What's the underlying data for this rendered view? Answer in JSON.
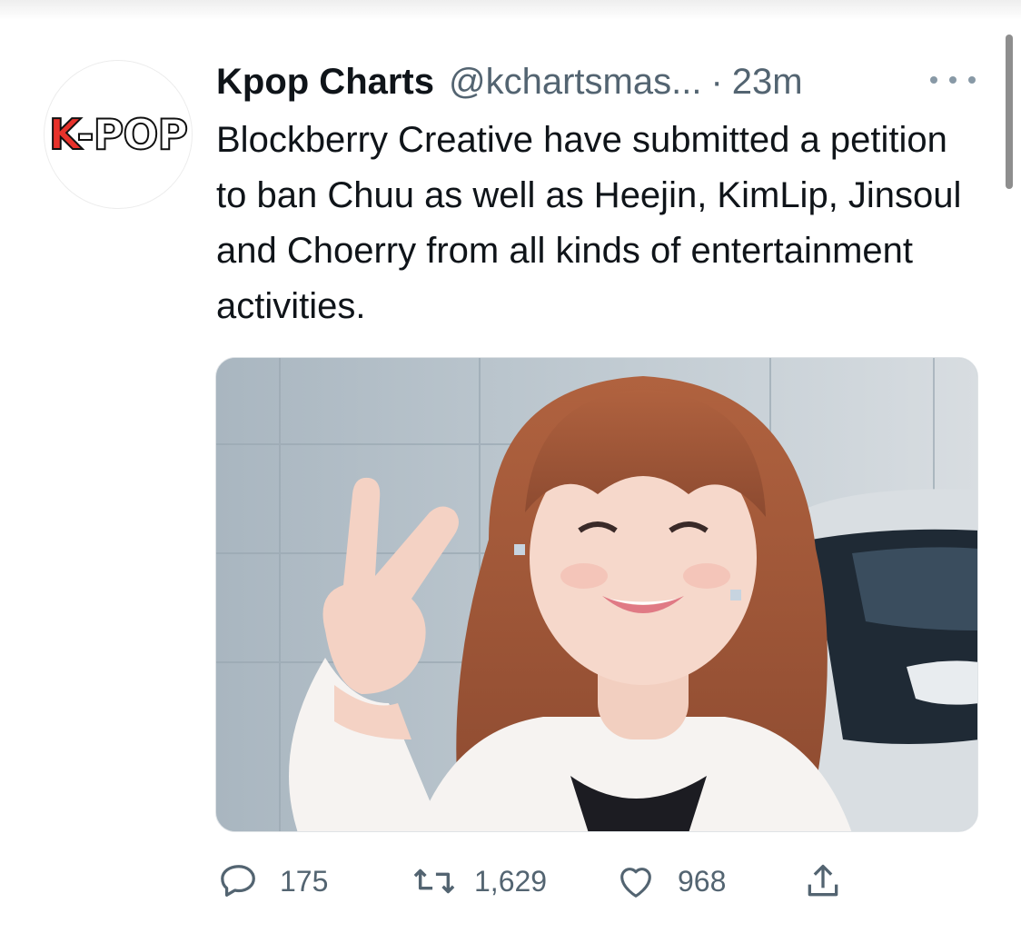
{
  "tweet": {
    "avatar_logo": {
      "k": "K",
      "rest": "-POP"
    },
    "author_name": "Kpop Charts",
    "author_handle": "@kchartsmas...",
    "separator": "·",
    "time": "23m",
    "text": "Blockberry Creative have submitted a petition to ban Chuu as well as Heejin, KimLip, Jinsoul and Choerry from all kinds of entertainment activities.",
    "media": {
      "description_icon": "photo-of-smiling-woman-making-peace-sign"
    }
  },
  "actions": {
    "reply_count": "175",
    "retweet_count": "1,629",
    "like_count": "968"
  },
  "colors": {
    "text_primary": "#0f1419",
    "text_secondary": "#536471",
    "logo_red": "#e8322b"
  }
}
